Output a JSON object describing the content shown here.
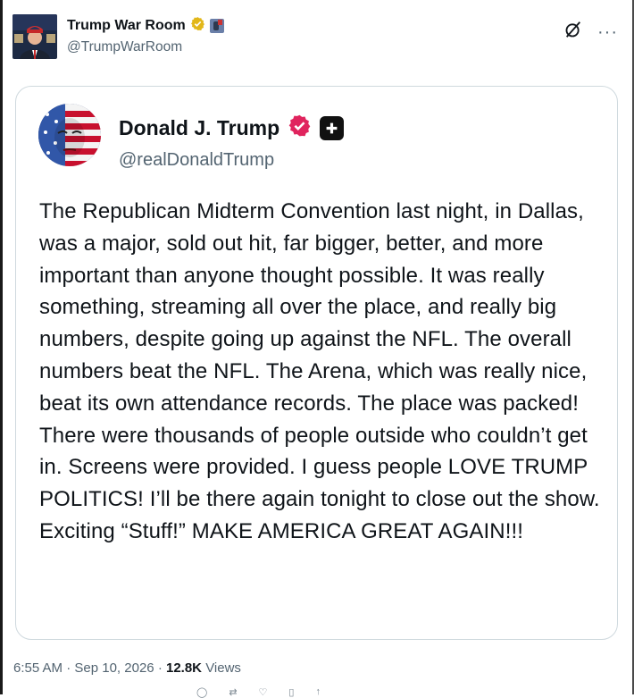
{
  "header": {
    "name": "Trump War Room",
    "handle": "@TrumpWarRoom",
    "grok_icon": "grok-icon",
    "more_icon": "more-icon"
  },
  "post": {
    "author_name": "Donald J. Trump",
    "author_handle": "@realDonaldTrump",
    "text": "The Republican Midterm Convention last night, in Dallas, was a major, sold out hit, far bigger, better, and more important than anyone thought possible. It was really something, streaming all over the place, and really big numbers, despite going up against the NFL. The overall numbers beat the NFL. The Arena, which was really nice, beat its own attendance records. The place was packed! There were thousands of people outside who couldn’t get in. Screens were provided. I guess people LOVE TRUMP POLITICS! I’ll be there again tonight to close out the show. Exciting “Stuff!” MAKE AMERICA GREAT AGAIN!!!"
  },
  "meta": {
    "time": "6:55 AM",
    "separator": "·",
    "date": "Sep 10, 2026",
    "views_count": "12.8K",
    "views_label": "Views"
  },
  "colors": {
    "verified_gold": "#e2b719",
    "verified_pink": "#e0245e",
    "text_primary": "#0f1419",
    "text_secondary": "#536471",
    "border": "#cfd9de"
  }
}
